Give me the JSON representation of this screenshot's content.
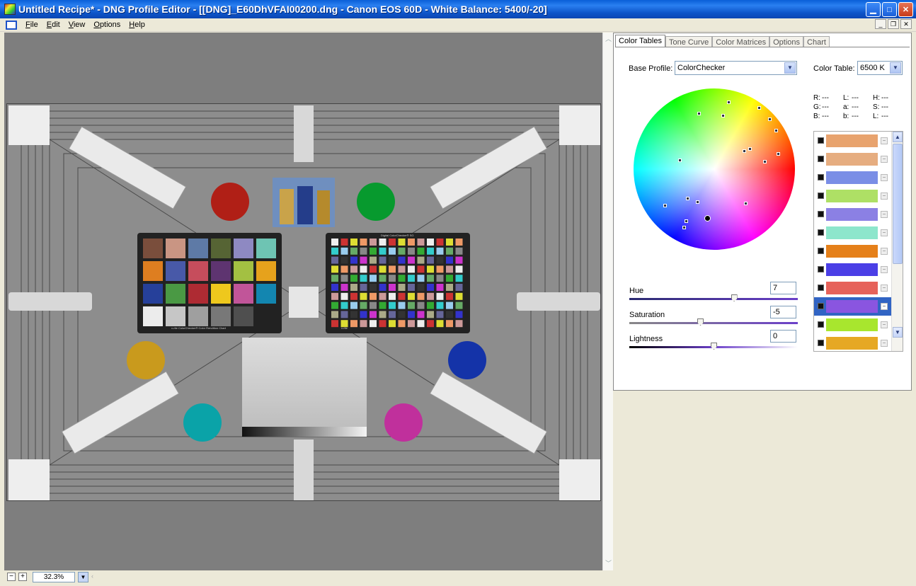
{
  "window": {
    "title": "Untitled Recipe* - DNG Profile Editor - [[DNG]_E60DhVFAI00200.dng  - Canon EOS 60D - White Balance: 5400/-20]",
    "minimize": "▁",
    "maximize": "□",
    "close": "✕"
  },
  "menu": {
    "items": [
      "File",
      "Edit",
      "View",
      "Options",
      "Help"
    ],
    "mdi": [
      "_",
      "❐",
      "✕"
    ]
  },
  "viewer": {
    "zoom": "32.3%",
    "zoom_out": "−",
    "zoom_in": "+"
  },
  "chart_labels": {
    "left_checker_caption": "x-rite ColorChecker® Color Rendition Chart",
    "right_checker_title": "Digital ColorChecker® SG",
    "right_checker_caption": "x-rite"
  },
  "panel": {
    "tabs": [
      "Color Tables",
      "Tone Curve",
      "Color Matrices",
      "Options",
      "Chart"
    ],
    "active_tab": "Color Tables",
    "base_profile_label": "Base Profile:",
    "base_profile_value": "ColorChecker",
    "color_table_label": "Color Table:",
    "color_table_value": "6500 K",
    "readout": {
      "r_label": "R:",
      "r_value": "---",
      "l1_label": "L:",
      "l1_value": "---",
      "h_label": "H:",
      "h_value": "---",
      "g_label": "G:",
      "g_value": "---",
      "a_label": "a:",
      "a_value": "---",
      "s_label": "S:",
      "s_value": "---",
      "b_label": "B:",
      "b_value": "---",
      "b2_label": "b:",
      "b2_value": "---",
      "l2_label": "L:",
      "l2_value": "---"
    },
    "hue_label": "Hue",
    "hue_value": "7",
    "hue_position": 0.62,
    "saturation_label": "Saturation",
    "saturation_value": "-5",
    "saturation_position": 0.42,
    "lightness_label": "Lightness",
    "lightness_value": "0",
    "lightness_position": 0.5,
    "swatches": [
      {
        "color": "#e8a36e",
        "selected": false
      },
      {
        "color": "#e6ad80",
        "selected": false
      },
      {
        "color": "#7a8ee6",
        "selected": false
      },
      {
        "color": "#aee065",
        "selected": false
      },
      {
        "color": "#8b80e4",
        "selected": false
      },
      {
        "color": "#8de6cc",
        "selected": false
      },
      {
        "color": "#e5801a",
        "selected": false
      },
      {
        "color": "#4b3fe6",
        "selected": false
      },
      {
        "color": "#e6625a",
        "selected": false
      },
      {
        "color": "#8a55e0",
        "selected": true
      },
      {
        "color": "#a8e62e",
        "selected": false
      },
      {
        "color": "#e6a824",
        "selected": false
      }
    ],
    "swatch_button": "−",
    "scroll_up": "▲",
    "scroll_down": "▼"
  },
  "colors": {
    "title_blue": "#0a5fd8",
    "selection": "#3164c4",
    "chart_bg": "#8d8d8d"
  },
  "icons": {
    "app": "app-icon",
    "document": "document-icon",
    "dropdown": "chevron-down-icon"
  }
}
